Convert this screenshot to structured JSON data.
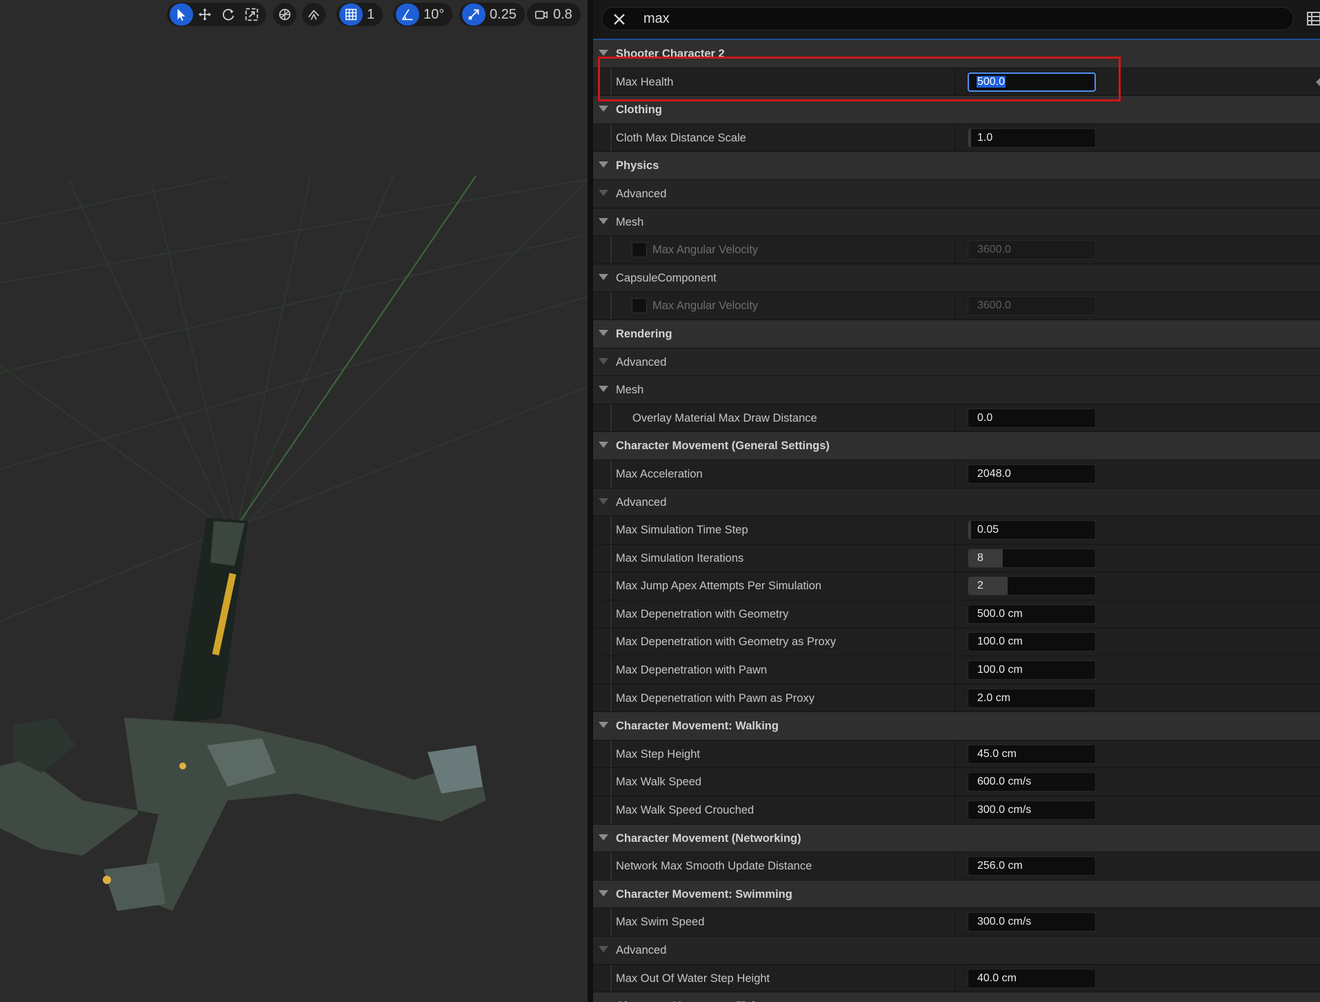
{
  "viewport_toolbar": {
    "groups": [
      {
        "items": [
          {
            "icon": "select-arrow-icon",
            "active": true
          },
          {
            "icon": "move-icon",
            "active": false
          },
          {
            "icon": "rotate-icon",
            "active": false
          },
          {
            "icon": "scale-icon",
            "active": false
          }
        ]
      },
      {
        "items": [
          {
            "icon": "world-local-icon",
            "active": false
          }
        ]
      },
      {
        "items": [
          {
            "icon": "surface-snap-icon",
            "active": false
          }
        ]
      },
      {
        "items": [
          {
            "icon": "grid-snap-icon",
            "active": true
          }
        ],
        "value": "1"
      },
      {
        "items": [
          {
            "icon": "angle-snap-icon",
            "active": true
          }
        ],
        "value": "10°"
      },
      {
        "items": [
          {
            "icon": "scale-snap-icon",
            "active": true
          }
        ],
        "value": "0.25"
      },
      {
        "items": [
          {
            "icon": "camera-speed-icon",
            "active": false
          }
        ],
        "value": "0.8"
      }
    ]
  },
  "search": {
    "value": "max"
  },
  "rows": [
    {
      "type": "cat",
      "label": "Shooter Character 2"
    },
    {
      "type": "prop",
      "label": "Max Health",
      "value": "500.0",
      "focused": true
    },
    {
      "type": "cat",
      "label": "Clothing"
    },
    {
      "type": "prop",
      "label": "Cloth Max Distance Scale",
      "value": "1.0",
      "fill": 0.02
    },
    {
      "type": "cat",
      "label": "Physics"
    },
    {
      "type": "sub",
      "label": "Advanced",
      "muted": true
    },
    {
      "type": "sub",
      "label": "Mesh"
    },
    {
      "type": "prop",
      "label": "Max Angular Velocity",
      "value": "3600.0",
      "disabled": true,
      "checkbox": true
    },
    {
      "type": "sub",
      "label": "CapsuleComponent"
    },
    {
      "type": "prop",
      "label": "Max Angular Velocity",
      "value": "3600.0",
      "disabled": true,
      "checkbox": true
    },
    {
      "type": "cat",
      "label": "Rendering"
    },
    {
      "type": "sub",
      "label": "Advanced",
      "muted": true
    },
    {
      "type": "sub",
      "label": "Mesh"
    },
    {
      "type": "prop",
      "label": "Overlay Material Max Draw Distance",
      "value": "0.0",
      "indent": true
    },
    {
      "type": "cat",
      "label": "Character Movement (General Settings)"
    },
    {
      "type": "prop",
      "label": "Max Acceleration",
      "value": "2048.0"
    },
    {
      "type": "sub",
      "label": "Advanced",
      "muted": true
    },
    {
      "type": "prop",
      "label": "Max Simulation Time Step",
      "value": "0.05",
      "fill": 0.02
    },
    {
      "type": "prop",
      "label": "Max Simulation Iterations",
      "value": "8",
      "fill": 0.27
    },
    {
      "type": "prop",
      "label": "Max Jump Apex Attempts Per Simulation",
      "value": "2",
      "fill": 0.31
    },
    {
      "type": "prop",
      "label": "Max Depenetration with Geometry",
      "value": "500.0 cm"
    },
    {
      "type": "prop",
      "label": "Max Depenetration with Geometry as Proxy",
      "value": "100.0 cm"
    },
    {
      "type": "prop",
      "label": "Max Depenetration with Pawn",
      "value": "100.0 cm"
    },
    {
      "type": "prop",
      "label": "Max Depenetration with Pawn as Proxy",
      "value": "2.0 cm"
    },
    {
      "type": "cat",
      "label": "Character Movement: Walking"
    },
    {
      "type": "prop",
      "label": "Max Step Height",
      "value": "45.0 cm"
    },
    {
      "type": "prop",
      "label": "Max Walk Speed",
      "value": "600.0 cm/s"
    },
    {
      "type": "prop",
      "label": "Max Walk Speed Crouched",
      "value": "300.0 cm/s"
    },
    {
      "type": "cat",
      "label": "Character Movement (Networking)"
    },
    {
      "type": "prop",
      "label": "Network Max Smooth Update Distance",
      "value": "256.0 cm"
    },
    {
      "type": "cat",
      "label": "Character Movement: Swimming"
    },
    {
      "type": "prop",
      "label": "Max Swim Speed",
      "value": "300.0 cm/s"
    },
    {
      "type": "sub",
      "label": "Advanced",
      "muted": true
    },
    {
      "type": "prop",
      "label": "Max Out Of Water Step Height",
      "value": "40.0 cm"
    },
    {
      "type": "cat",
      "label": "Character Movement: Flying"
    }
  ],
  "colors": {
    "accent": "#1e5fd6",
    "highlight_box": "#d01717",
    "panel_bg": "#202020"
  }
}
